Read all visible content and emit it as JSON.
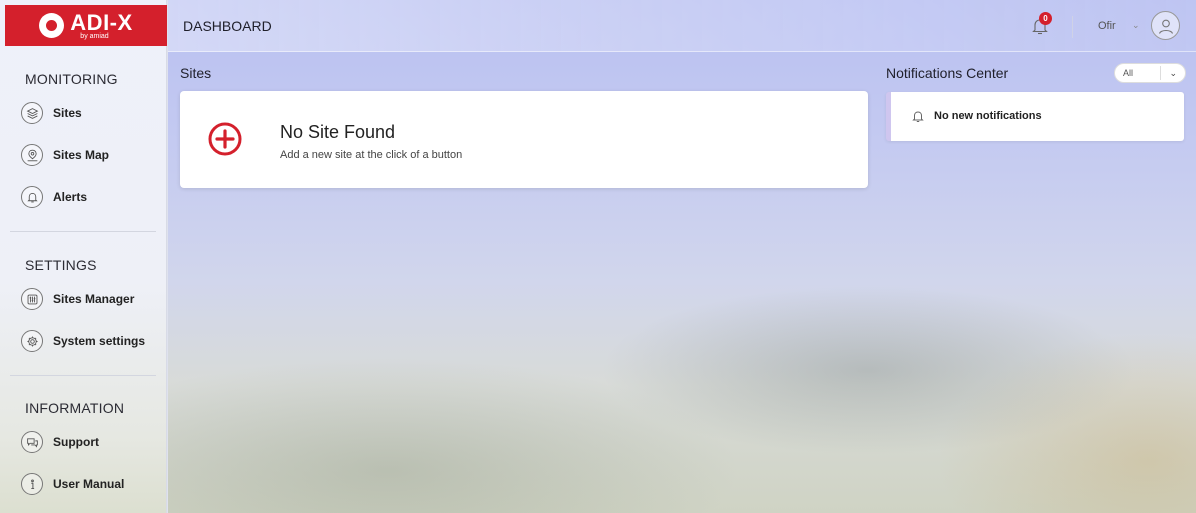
{
  "brand": {
    "name": "ADI-X",
    "tagline": "by amiad",
    "color": "#d4202c"
  },
  "header": {
    "title": "DASHBOARD",
    "notification_count": "0",
    "user_name": "Ofir"
  },
  "sidebar": {
    "sections": [
      {
        "title": "MONITORING",
        "items": [
          {
            "label": "Sites",
            "icon": "layers-icon"
          },
          {
            "label": "Sites Map",
            "icon": "map-pin-icon"
          },
          {
            "label": "Alerts",
            "icon": "bell-icon"
          }
        ]
      },
      {
        "title": "SETTINGS",
        "items": [
          {
            "label": "Sites Manager",
            "icon": "sliders-icon"
          },
          {
            "label": "System settings",
            "icon": "gear-icon"
          }
        ]
      },
      {
        "title": "INFORMATION",
        "items": [
          {
            "label": "Support",
            "icon": "chat-icon"
          },
          {
            "label": "User Manual",
            "icon": "info-icon"
          }
        ]
      }
    ]
  },
  "sites": {
    "heading": "Sites",
    "empty_title": "No Site Found",
    "empty_subtitle": "Add a new site at the click of a button"
  },
  "notifications": {
    "heading": "Notifications Center",
    "filter_value": "All",
    "empty_text": "No new notifications"
  }
}
